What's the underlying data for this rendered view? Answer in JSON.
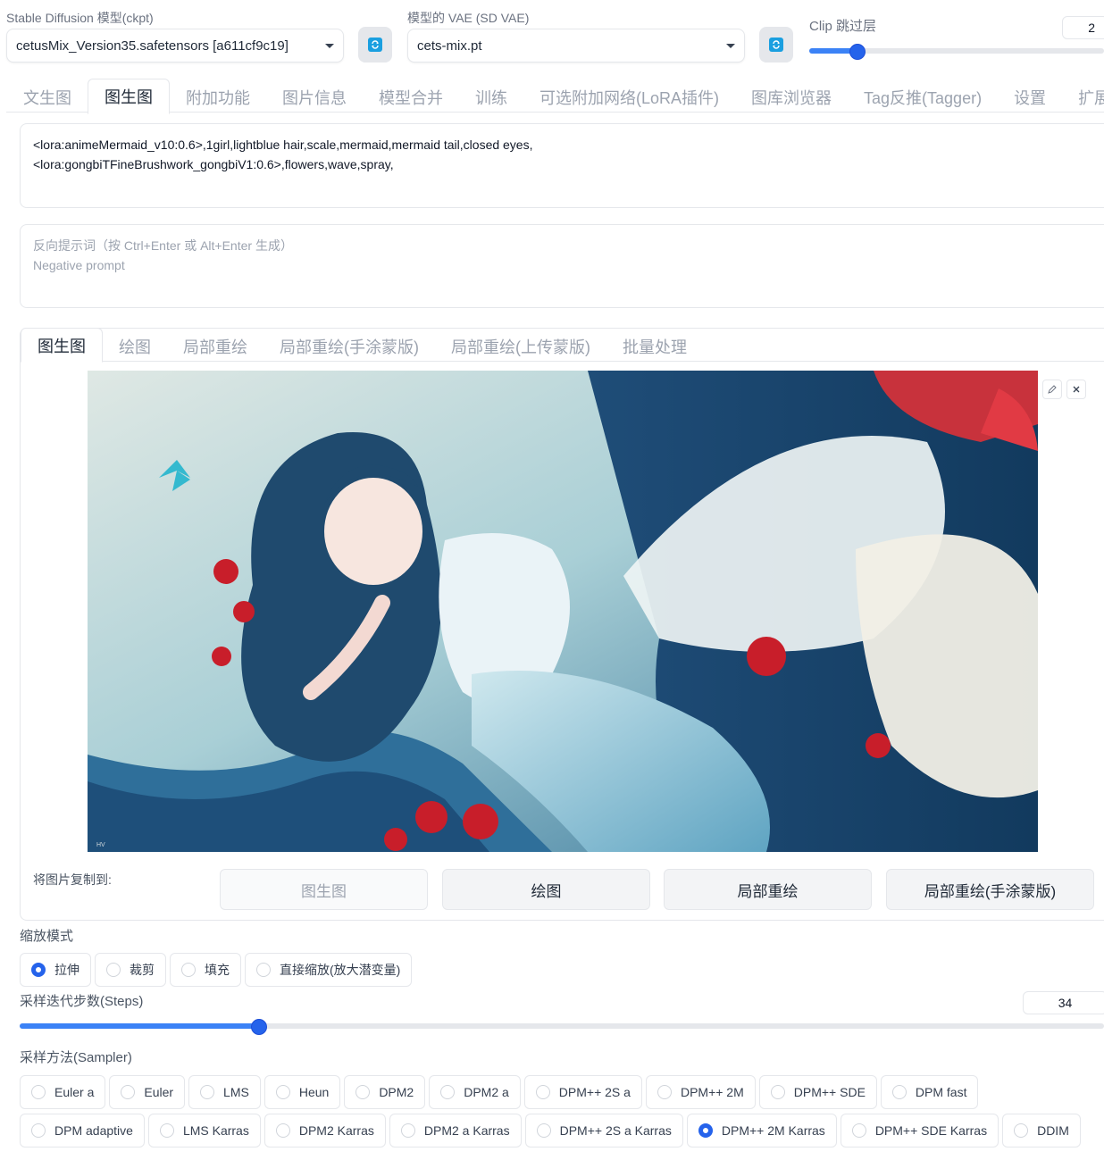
{
  "header": {
    "ckpt_label": "Stable Diffusion 模型(ckpt)",
    "ckpt_value": "cetusMix_Version35.safetensors [a611cf9c19]",
    "vae_label": "模型的 VAE (SD VAE)",
    "vae_value": "cets-mix.pt",
    "clip_label": "Clip 跳过层",
    "clip_value": "2",
    "clip_slider_fraction": 0.16
  },
  "main_tabs": [
    "文生图",
    "图生图",
    "附加功能",
    "图片信息",
    "模型合并",
    "训练",
    "可选附加网络(LoRA插件)",
    "图库浏览器",
    "Tag反推(Tagger)",
    "设置",
    "扩展"
  ],
  "main_tab_active": 1,
  "prompt": {
    "line1": "<lora:animeMermaid_v10:0.6>,1girl,lightblue hair,scale,mermaid,mermaid tail,closed eyes,",
    "line2": "<lora:gongbiTFineBrushwork_gongbiV1:0.6>,flowers,wave,spray,"
  },
  "negative_prompt": {
    "placeholder1": "反向提示词（按 Ctrl+Enter 或 Alt+Enter 生成）",
    "placeholder2": "Negative prompt"
  },
  "sub_tabs": [
    "图生图",
    "绘图",
    "局部重绘",
    "局部重绘(手涂蒙版)",
    "局部重绘(上传蒙版)",
    "批量处理"
  ],
  "sub_tab_active": 0,
  "copy_to": {
    "label": "将图片复制到:",
    "buttons": [
      "图生图",
      "绘图",
      "局部重绘",
      "局部重绘(手涂蒙版)"
    ]
  },
  "resize_mode": {
    "label": "缩放模式",
    "options": [
      "拉伸",
      "裁剪",
      "填充",
      "直接缩放(放大潜变量)"
    ],
    "selected": 0
  },
  "steps": {
    "label": "采样迭代步数(Steps)",
    "value": "34",
    "slider_fraction": 0.22
  },
  "sampler": {
    "label": "采样方法(Sampler)",
    "row1": [
      "Euler a",
      "Euler",
      "LMS",
      "Heun",
      "DPM2",
      "DPM2 a",
      "DPM++ 2S a",
      "DPM++ 2M",
      "DPM++ SDE",
      "DPM fast"
    ],
    "row2": [
      "DPM adaptive",
      "LMS Karras",
      "DPM2 Karras",
      "DPM2 a Karras",
      "DPM++ 2S a Karras",
      "DPM++ 2M Karras",
      "DPM++ SDE Karras",
      "DDIM"
    ],
    "selected": "DPM++ 2M Karras"
  },
  "image_watermark": "HV",
  "colors": {
    "accent": "#2563eb",
    "refresh": "#1a9fe0"
  }
}
